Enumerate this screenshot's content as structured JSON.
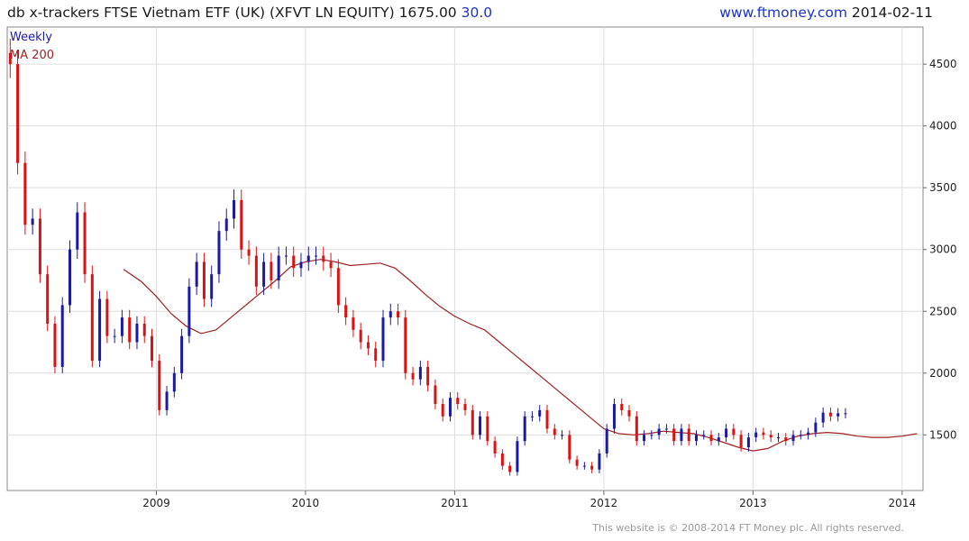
{
  "header": {
    "title": "db x-trackers FTSE Vietnam ETF (UK)  (XFVT LN EQUITY) 1675.00",
    "change": "30.0",
    "site": "www.ftmoney.com",
    "date": "2014-02-11"
  },
  "footer": {
    "copyright": "This website is © 2008-2014 FT Money plc. All rights reserved."
  },
  "colors": {
    "up_bar": "#1a1aa6",
    "down_bar": "#dd1111",
    "ma_line": "#a02020",
    "grid": "#dddddd",
    "weekly_label": "#1a1aa6",
    "ma_label": "#a02020"
  },
  "chart_data": {
    "type": "line",
    "legend": {
      "position": "top-left",
      "entries": [
        "Weekly",
        "MA 200"
      ]
    },
    "grid": true,
    "x_tick_labels": [
      "2009",
      "2010",
      "2011",
      "2012",
      "2013",
      "2014"
    ],
    "y_tick_labels": [
      "1500",
      "2000",
      "2500",
      "3000",
      "3500",
      "4000",
      "4500"
    ],
    "ylim": [
      1050,
      4800
    ],
    "xlim": [
      2008.0,
      2014.14
    ],
    "y_axis_position": "right",
    "series": [
      {
        "name": "Weekly",
        "style": "candles",
        "x": [
          2008.02,
          2008.07,
          2008.12,
          2008.17,
          2008.22,
          2008.27,
          2008.32,
          2008.37,
          2008.42,
          2008.47,
          2008.52,
          2008.57,
          2008.62,
          2008.67,
          2008.72,
          2008.77,
          2008.82,
          2008.87,
          2008.92,
          2008.97,
          2009.02,
          2009.07,
          2009.12,
          2009.17,
          2009.22,
          2009.27,
          2009.32,
          2009.37,
          2009.42,
          2009.47,
          2009.52,
          2009.57,
          2009.62,
          2009.67,
          2009.72,
          2009.77,
          2009.82,
          2009.87,
          2009.92,
          2009.97,
          2010.02,
          2010.07,
          2010.12,
          2010.17,
          2010.22,
          2010.27,
          2010.32,
          2010.37,
          2010.42,
          2010.47,
          2010.52,
          2010.57,
          2010.62,
          2010.67,
          2010.72,
          2010.77,
          2010.82,
          2010.87,
          2010.92,
          2010.97,
          2011.02,
          2011.07,
          2011.12,
          2011.17,
          2011.22,
          2011.27,
          2011.32,
          2011.37,
          2011.42,
          2011.47,
          2011.52,
          2011.57,
          2011.62,
          2011.67,
          2011.72,
          2011.77,
          2011.82,
          2011.87,
          2011.92,
          2011.97,
          2012.02,
          2012.07,
          2012.12,
          2012.17,
          2012.22,
          2012.27,
          2012.32,
          2012.37,
          2012.42,
          2012.47,
          2012.52,
          2012.57,
          2012.62,
          2012.67,
          2012.72,
          2012.77,
          2012.82,
          2012.87,
          2012.92,
          2012.97,
          2013.02,
          2013.07,
          2013.12,
          2013.17,
          2013.22,
          2013.27,
          2013.32,
          2013.37,
          2013.42,
          2013.47,
          2013.52,
          2013.57,
          2013.62,
          2013.67,
          2013.72,
          2013.77,
          2013.82,
          2013.87,
          2013.92,
          2013.97,
          2014.02,
          2014.07,
          2014.11
        ],
        "close": [
          4500,
          3700,
          3200,
          3250,
          2800,
          2400,
          2050,
          2550,
          3000,
          3300,
          2800,
          2100,
          2600,
          2300,
          2300,
          2450,
          2250,
          2400,
          2300,
          2100,
          1700,
          1850,
          2000,
          2300,
          2700,
          2900,
          2600,
          2800,
          3150,
          3250,
          3400,
          3000,
          2950,
          2700,
          2900,
          2750,
          2950,
          2950,
          2850,
          2900,
          2950,
          2950,
          2900,
          2850,
          2550,
          2450,
          2350,
          2250,
          2200,
          2100,
          2450,
          2500,
          2450,
          2000,
          1950,
          2050,
          1900,
          1750,
          1650,
          1800,
          1750,
          1700,
          1500,
          1650,
          1450,
          1350,
          1250,
          1200,
          1450,
          1650,
          1650,
          1700,
          1550,
          1500,
          1500,
          1300,
          1250,
          1250,
          1220,
          1350,
          1550,
          1750,
          1700,
          1650,
          1450,
          1500,
          1500,
          1550,
          1550,
          1450,
          1550,
          1450,
          1500,
          1500,
          1450,
          1480,
          1550,
          1500,
          1400,
          1480,
          1520,
          1500,
          1480,
          1480,
          1450,
          1500,
          1500,
          1520,
          1600,
          1680,
          1650,
          1675,
          1675
        ]
      },
      {
        "name": "MA 200",
        "style": "line",
        "x": [
          2008.78,
          2008.9,
          2009.0,
          2009.1,
          2009.2,
          2009.3,
          2009.4,
          2009.5,
          2009.6,
          2009.7,
          2009.8,
          2009.9,
          2010.0,
          2010.1,
          2010.2,
          2010.3,
          2010.4,
          2010.5,
          2010.6,
          2010.7,
          2010.8,
          2010.9,
          2011.0,
          2011.1,
          2011.2,
          2011.3,
          2011.4,
          2011.5,
          2011.6,
          2011.7,
          2011.8,
          2011.9,
          2012.0,
          2012.1,
          2012.2,
          2012.3,
          2012.4,
          2012.5,
          2012.6,
          2012.7,
          2012.8,
          2012.9,
          2013.0,
          2013.1,
          2013.2,
          2013.3,
          2013.4,
          2013.5,
          2013.6,
          2013.7,
          2013.8,
          2013.9,
          2014.0,
          2014.1
        ],
        "values": [
          2840,
          2740,
          2620,
          2480,
          2380,
          2320,
          2350,
          2450,
          2550,
          2650,
          2750,
          2860,
          2900,
          2920,
          2900,
          2870,
          2880,
          2890,
          2850,
          2750,
          2640,
          2540,
          2460,
          2400,
          2350,
          2250,
          2150,
          2050,
          1950,
          1850,
          1750,
          1650,
          1550,
          1510,
          1500,
          1510,
          1530,
          1520,
          1510,
          1480,
          1440,
          1400,
          1370,
          1390,
          1450,
          1490,
          1510,
          1520,
          1510,
          1490,
          1480,
          1480,
          1490,
          1510
        ]
      }
    ]
  }
}
